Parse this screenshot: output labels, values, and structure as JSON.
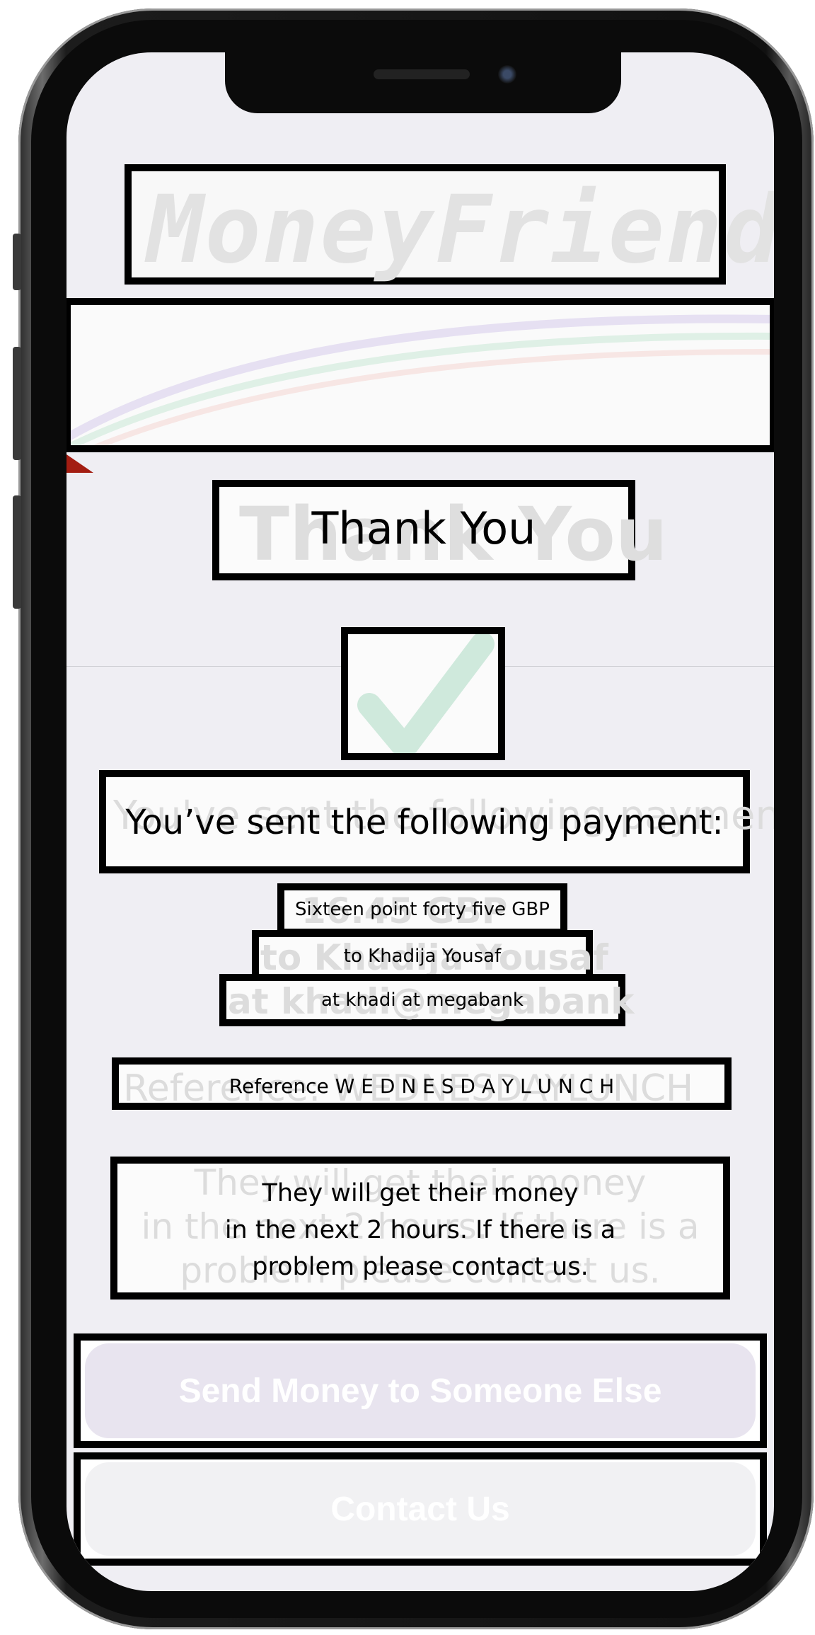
{
  "app": {
    "logo_text": "MoneyFriend"
  },
  "thank_you": {
    "ghost": "Thank You",
    "label": "Thank You"
  },
  "confirmation": {
    "ghost": "You've sent the following payment:",
    "label": "You’ve sent the following payment:"
  },
  "payment": {
    "amount_ghost": "16.45 GBP",
    "amount_label": "Sixteen point forty five GBP",
    "recipient_ghost": "to Khadija Yousaf",
    "recipient_label": "to Khadija Yousaf",
    "bank_ghost": "at khadi@megabank",
    "bank_label": "at khadi at megabank"
  },
  "reference": {
    "ghost": "Reference: WEDNESDAYLUNCH",
    "label": "Reference W E D N E S D A Y L U N C H"
  },
  "info": {
    "ghost_line1": "They will get their money",
    "ghost_line2": "in the next 2 hours. If there is a",
    "ghost_line3": "problem please contact us.",
    "line1": "They will get their money",
    "line2": "in the next 2 hours. If there is a",
    "line3": "problem please contact us."
  },
  "buttons": {
    "send_again": "Send Money to Someone Else",
    "contact": "Contact Us"
  },
  "icons": {
    "success": "checkmark-icon"
  },
  "colors": {
    "screen_bg": "#efeef3",
    "check_green": "#cfe9dc",
    "accent_red": "#a31d12"
  }
}
